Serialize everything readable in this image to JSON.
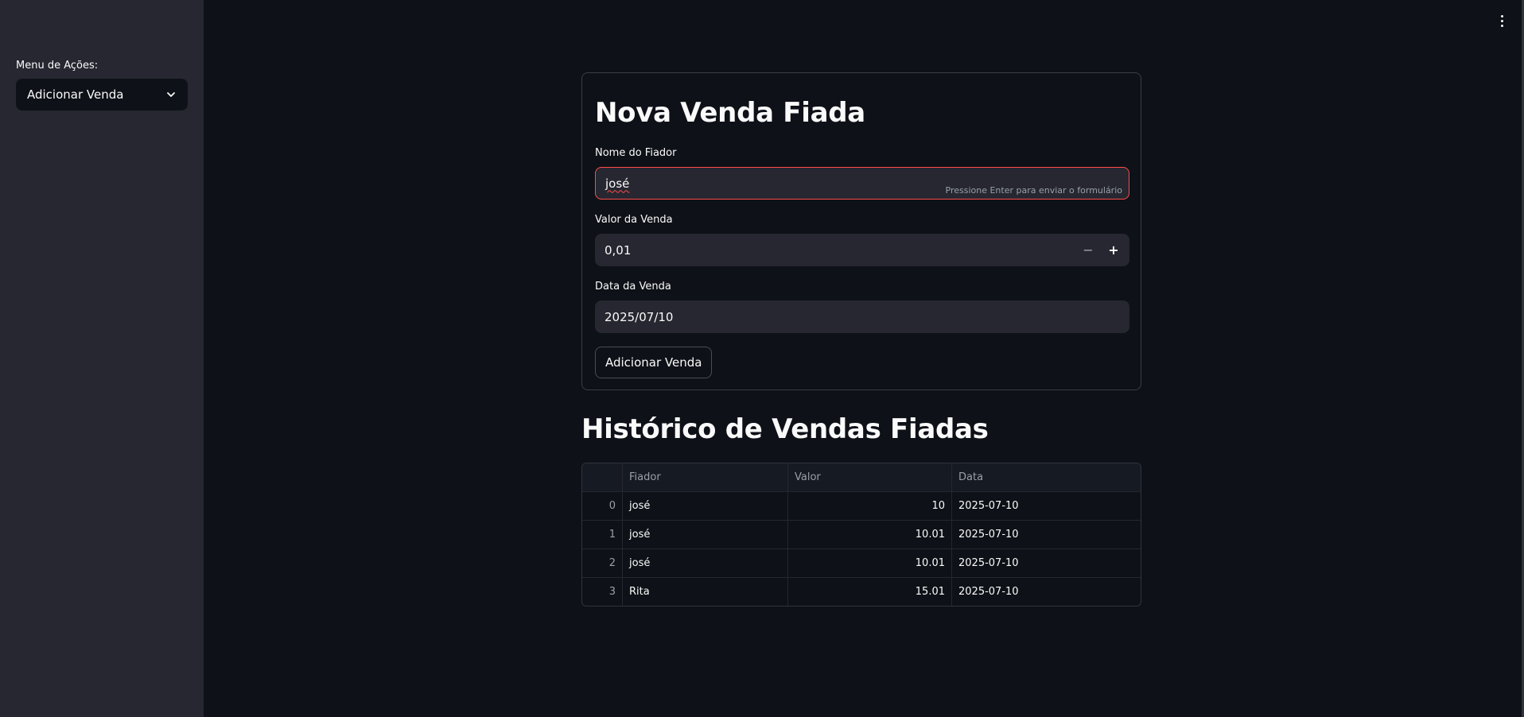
{
  "sidebar": {
    "label": "Menu de Ações:",
    "select": {
      "value": "Adicionar Venda"
    }
  },
  "form": {
    "title": "Nova Venda Fiada",
    "name_label": "Nome do Fiador",
    "name_value": "josé",
    "enter_hint": "Pressione Enter para enviar o formulário",
    "value_label": "Valor da Venda",
    "value_value": "0,01",
    "minus": "−",
    "plus": "+",
    "date_label": "Data da Venda",
    "date_value": "2025/07/10",
    "submit_label": "Adicionar Venda",
    "error_color": "#ff4b4b"
  },
  "history": {
    "title": "Histórico de Vendas Fiadas",
    "columns": [
      "",
      "Fiador",
      "Valor",
      "Data"
    ],
    "rows": [
      {
        "index": "0",
        "fiador": "josé",
        "valor": "10",
        "data": "2025-07-10"
      },
      {
        "index": "1",
        "fiador": "josé",
        "valor": "10.01",
        "data": "2025-07-10"
      },
      {
        "index": "2",
        "fiador": "josé",
        "valor": "10.01",
        "data": "2025-07-10"
      },
      {
        "index": "3",
        "fiador": "Rita",
        "valor": "15.01",
        "data": "2025-07-10"
      }
    ]
  },
  "icons": {
    "select_chevron": "chevron-down-icon",
    "main_menu": "kebab-menu-icon"
  },
  "colors": {
    "background": "#0e1117",
    "sidebar": "#262730",
    "input": "#262730"
  }
}
